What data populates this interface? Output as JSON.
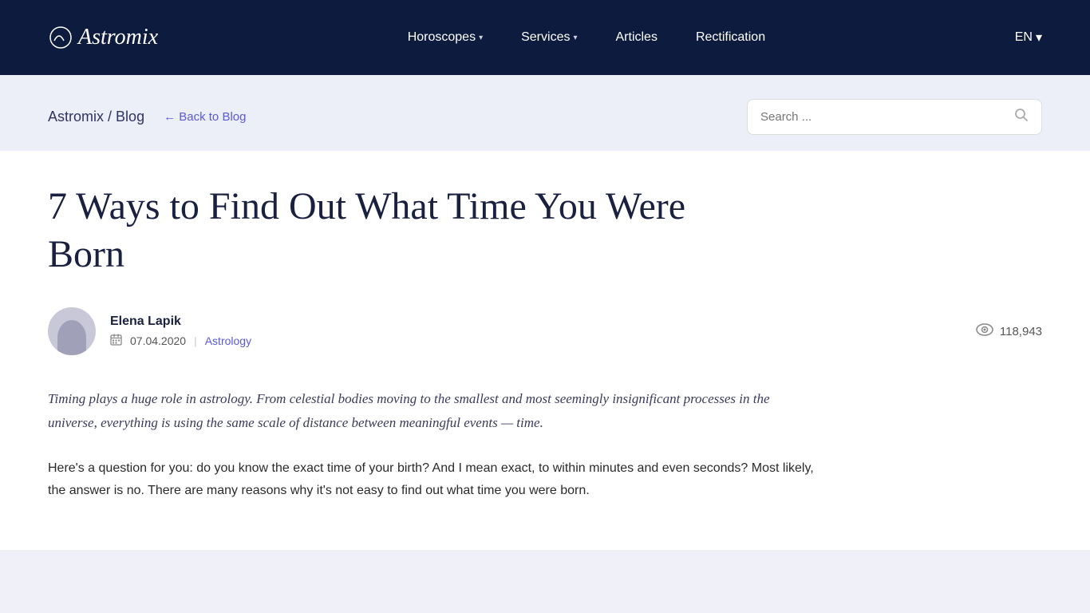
{
  "nav": {
    "logo": "Astromix",
    "menu": [
      {
        "label": "Horoscopes",
        "hasDropdown": true
      },
      {
        "label": "Services",
        "hasDropdown": true
      },
      {
        "label": "Articles",
        "hasDropdown": false
      },
      {
        "label": "Rectification",
        "hasDropdown": false
      }
    ],
    "lang": "EN"
  },
  "breadcrumb": {
    "site": "Astromix",
    "separator": "/",
    "section": "Blog",
    "back_label": "← Back to Blog"
  },
  "search": {
    "placeholder": "Search ..."
  },
  "article": {
    "title": "7 Ways to Find Out What Time You Were Born",
    "author_name": "Elena Lapik",
    "date": "07.04.2020",
    "category": "Astrology",
    "views": "118,943",
    "intro": "Timing plays a huge role in astrology. From celestial bodies moving to the smallest and most seemingly insignificant processes in the universe, everything is using the same scale of distance between meaningful events — time.",
    "body": "Here's a question for you: do you know the exact time of your birth? And I mean exact, to within minutes and even seconds? Most likely, the answer is no. There are many reasons why it's not easy to find out what time you were born."
  }
}
